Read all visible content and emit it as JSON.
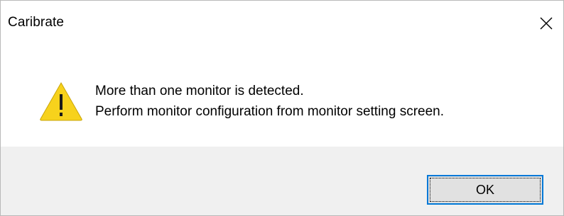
{
  "window": {
    "title": "Caribrate",
    "close_icon": "close-icon"
  },
  "message": {
    "icon": "warning-icon",
    "line1": "More than one monitor is detected.",
    "line2": "Perform monitor configuration from monitor setting screen."
  },
  "buttons": {
    "ok_label": "OK"
  },
  "colors": {
    "warning_fill": "#f7d21c",
    "focus_border": "#0078d7",
    "footer_bg": "#f0f0f0"
  }
}
